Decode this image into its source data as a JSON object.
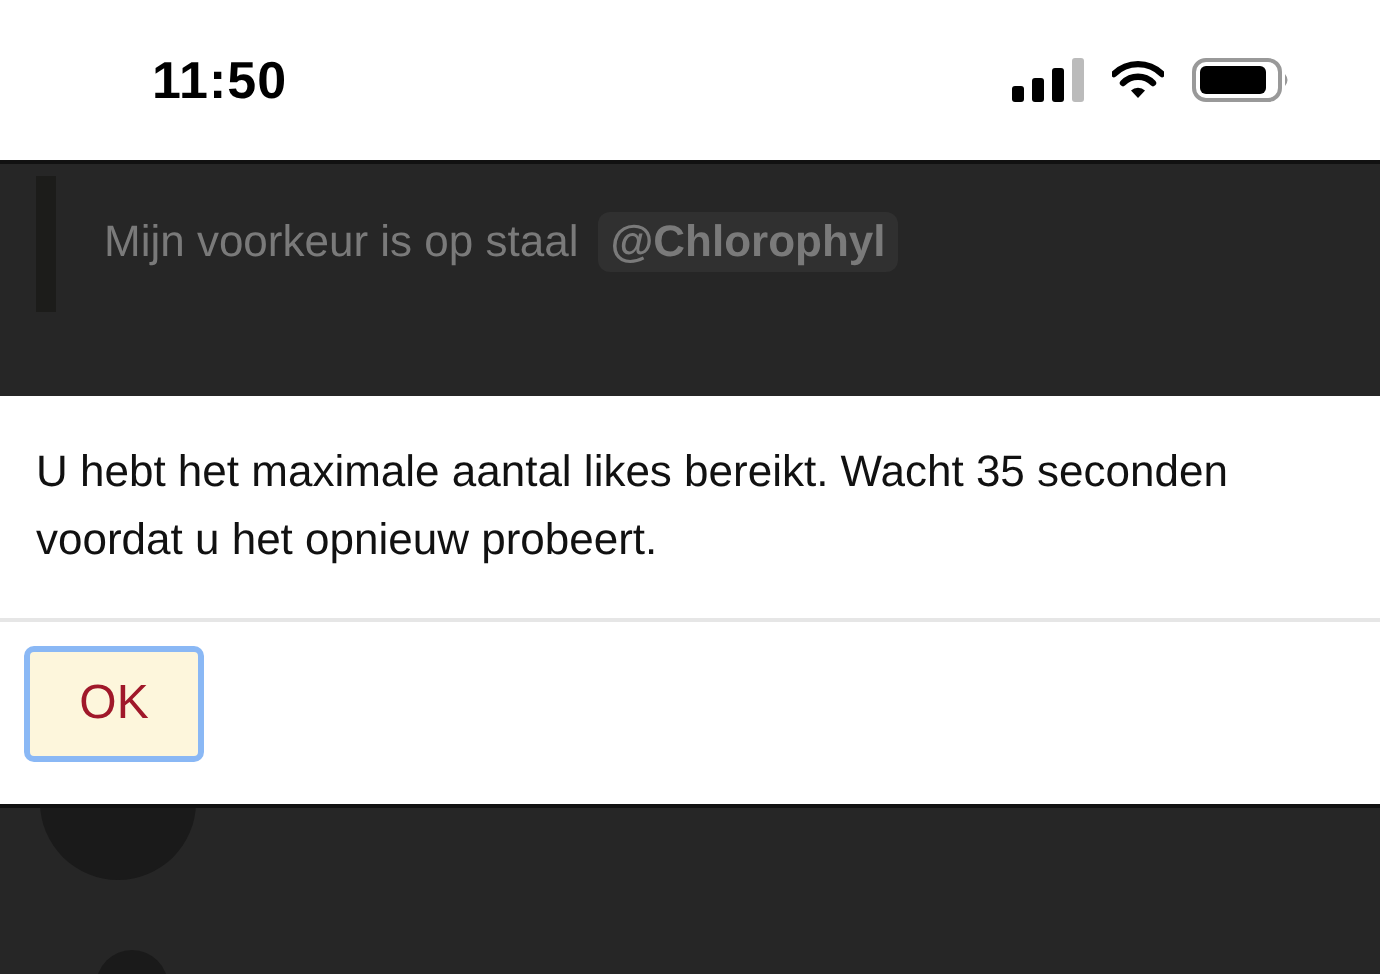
{
  "status_bar": {
    "time": "11:50"
  },
  "background_post": {
    "quote": "Mijn voorkeur is op staal",
    "mention": "@Chlorophyl"
  },
  "dialog": {
    "message": "U hebt het maximale aantal likes bereikt. Wacht 35 seconden voordat u het opnieuw probeert.",
    "buttons": [
      {
        "label": "OK",
        "selected": true
      }
    ]
  }
}
